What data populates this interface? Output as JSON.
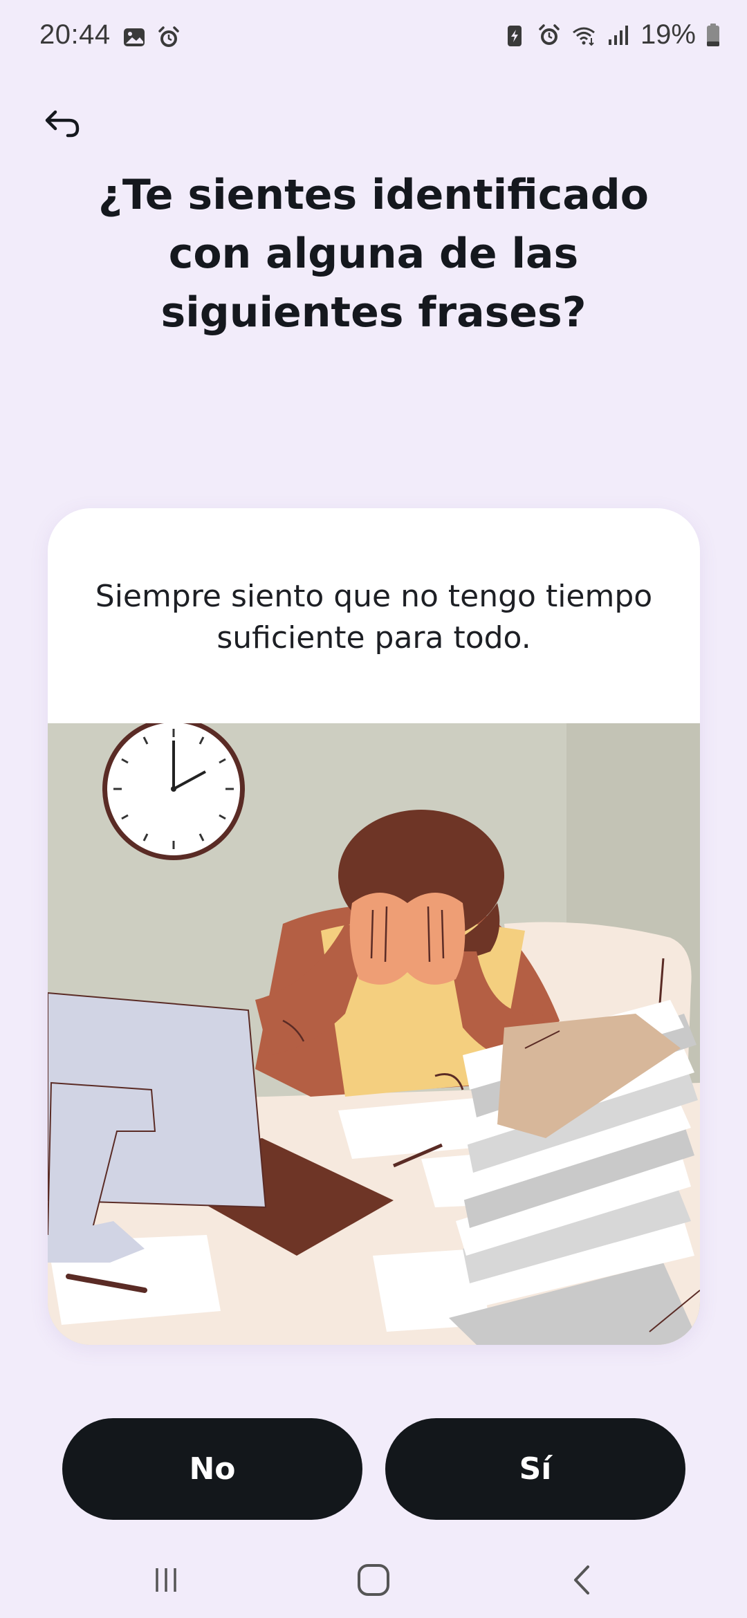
{
  "status_bar": {
    "time": "20:44",
    "battery_percent": "19%",
    "icons_left": [
      "gallery-icon",
      "alarm-icon"
    ],
    "icons_right": [
      "battery-saver-icon",
      "alarm-icon",
      "wifi-icon",
      "signal-icon",
      "battery-icon"
    ]
  },
  "header": {
    "back_icon": "back-arrow-icon",
    "title": "¿Te sientes identificado con alguna de las siguientes frases?"
  },
  "card": {
    "statement": "Siempre siento que no tengo tiempo suficiente para todo.",
    "illustration": "stressed-person-at-desk"
  },
  "actions": {
    "no_label": "No",
    "yes_label": "Sí"
  },
  "nav_bar": {
    "items": [
      "recent-apps-icon",
      "home-icon",
      "back-icon"
    ]
  },
  "colors": {
    "background": "#F2ECFA",
    "card": "#FFFFFF",
    "button": "#13171B",
    "button_text": "#FFFFFF",
    "title_text": "#15181E"
  }
}
